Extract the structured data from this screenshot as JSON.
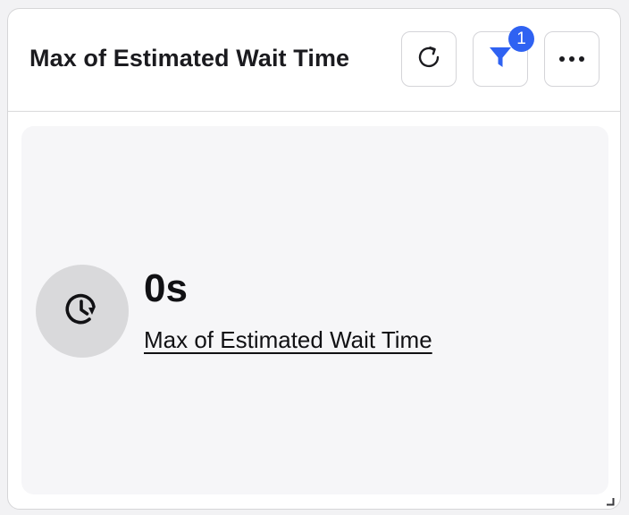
{
  "widget": {
    "title": "Max of Estimated Wait Time",
    "filter_badge_count": "1",
    "icons": {
      "refresh": "refresh-icon",
      "filter": "filter-icon",
      "more": "more-horizontal-icon",
      "metric": "clock-refresh-icon",
      "resize": "resize-handle-icon"
    },
    "colors": {
      "badge": "#2f62f2",
      "filter_icon": "#2f62f2"
    }
  },
  "metric": {
    "value": "0s",
    "label": "Max of Estimated Wait Time"
  }
}
